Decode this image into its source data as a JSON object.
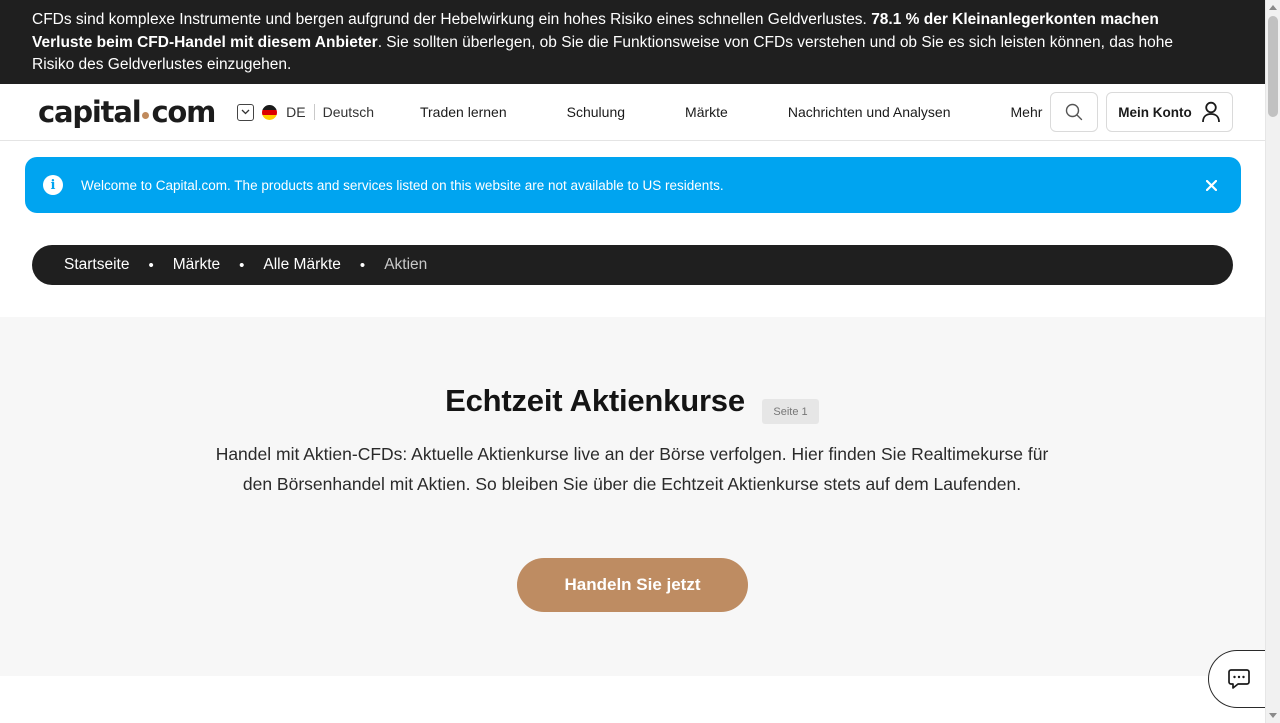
{
  "risk_banner": {
    "text_1": "CFDs sind komplexe Instrumente und bergen aufgrund der Hebelwirkung ein hohes Risiko eines schnellen Geldverlustes. ",
    "text_bold": "78.1 % der Kleinanlegerkonten machen Verluste beim CFD-Handel mit diesem Anbieter",
    "text_2": ". Sie sollten überlegen, ob Sie die Funktionsweise von CFDs verstehen und ob Sie es sich leisten können, das hohe Risiko des Geldverlustes einzugehen."
  },
  "header": {
    "logo_left": "capital",
    "logo_right": "com",
    "lang_code": "DE",
    "lang_name": "Deutsch",
    "nav": [
      "Traden lernen",
      "Schulung",
      "Märkte",
      "Nachrichten und Analysen",
      "Mehr"
    ],
    "account_label": "Mein Konto"
  },
  "notice": {
    "text": "Welcome to Capital.com. The products and services listed on this website are not available to US residents."
  },
  "breadcrumb": {
    "items": [
      "Startseite",
      "Märkte",
      "Alle Märkte"
    ],
    "current": "Aktien",
    "separator": "•"
  },
  "hero": {
    "title": "Echtzeit Aktienkurse",
    "page_badge": "Seite 1",
    "description": "Handel mit Aktien-CFDs: Aktuelle Aktienkurse live an der Börse verfolgen. Hier finden Sie Realtimekurse für den Börsenhandel mit Aktien. So bleiben Sie über die Echtzeit Aktienkurse stets auf dem Laufenden.",
    "cta_label": "Handeln Sie jetzt"
  },
  "colors": {
    "risk_bg": "#1f1f1f",
    "notice_bg": "#00a4f0",
    "brand_accent": "#be8c62",
    "hero_bg": "#f7f7f7"
  },
  "icons": {
    "lang_dropdown": "chevron-down-icon",
    "flag": "germany-flag-icon",
    "search": "search-icon",
    "account": "user-icon",
    "info": "info-icon",
    "close": "close-icon",
    "chat": "chat-icon"
  }
}
